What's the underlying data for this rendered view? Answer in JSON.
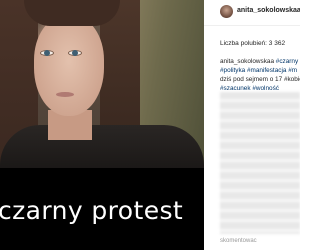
{
  "post": {
    "image_caption": "czarny protest",
    "author": "anita_sokolowskaa",
    "likes_label": "Liczba polubień:",
    "likes_count": "3 362",
    "caption_lines": [
      {
        "user": "anita_sokolowskaa",
        "text": " #czarny"
      },
      {
        "text": "#polityka #manifestacja #m"
      },
      {
        "text": "dziś pod sejmem o 17 #kobie"
      },
      {
        "text": "#szacunek #wolność"
      }
    ],
    "footer_user": "skomentowac"
  },
  "colors": {
    "banner": "#000000",
    "hashtag": "#003569",
    "text": "#262626"
  }
}
